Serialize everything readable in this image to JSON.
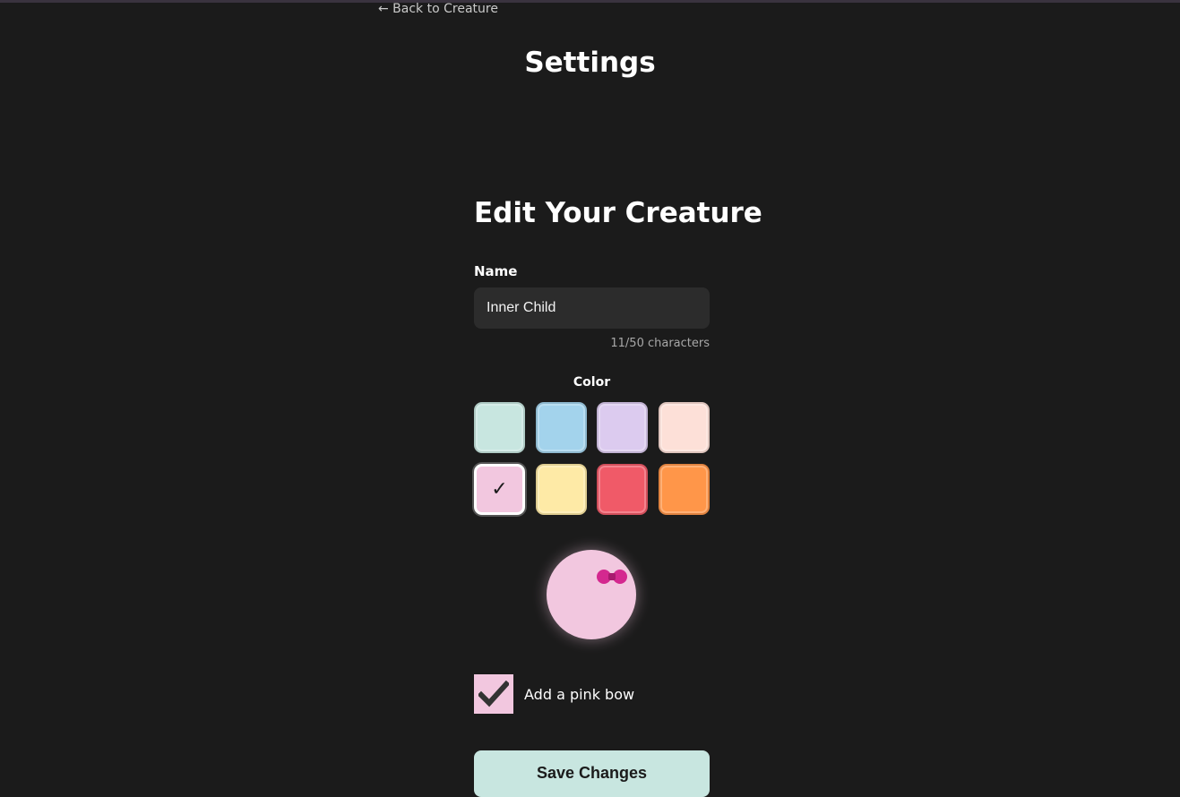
{
  "nav": {
    "back_label": "← Back to Creature"
  },
  "page": {
    "title": "Settings"
  },
  "form": {
    "title": "Edit Your Creature",
    "name_label": "Name",
    "name_value": "Inner Child",
    "char_count": "11/50 characters",
    "color_label": "Color",
    "colors": [
      {
        "name": "mint",
        "hex": "#c8e6e0",
        "selected": false
      },
      {
        "name": "sky-blue",
        "hex": "#a3d3ec",
        "selected": false
      },
      {
        "name": "lavender",
        "hex": "#dccbef",
        "selected": false
      },
      {
        "name": "peach",
        "hex": "#fde0d8",
        "selected": false
      },
      {
        "name": "pink",
        "hex": "#f2c7df",
        "selected": true
      },
      {
        "name": "yellow",
        "hex": "#feeaa6",
        "selected": false
      },
      {
        "name": "red",
        "hex": "#f05a68",
        "selected": false
      },
      {
        "name": "orange",
        "hex": "#ff9649",
        "selected": false
      }
    ],
    "selected_mark": "✓",
    "bow_label": "Add a pink bow",
    "bow_checked": true,
    "bow_color": "#d4288f",
    "creature_color": "#f2c7df",
    "save_label": "Save Changes"
  }
}
